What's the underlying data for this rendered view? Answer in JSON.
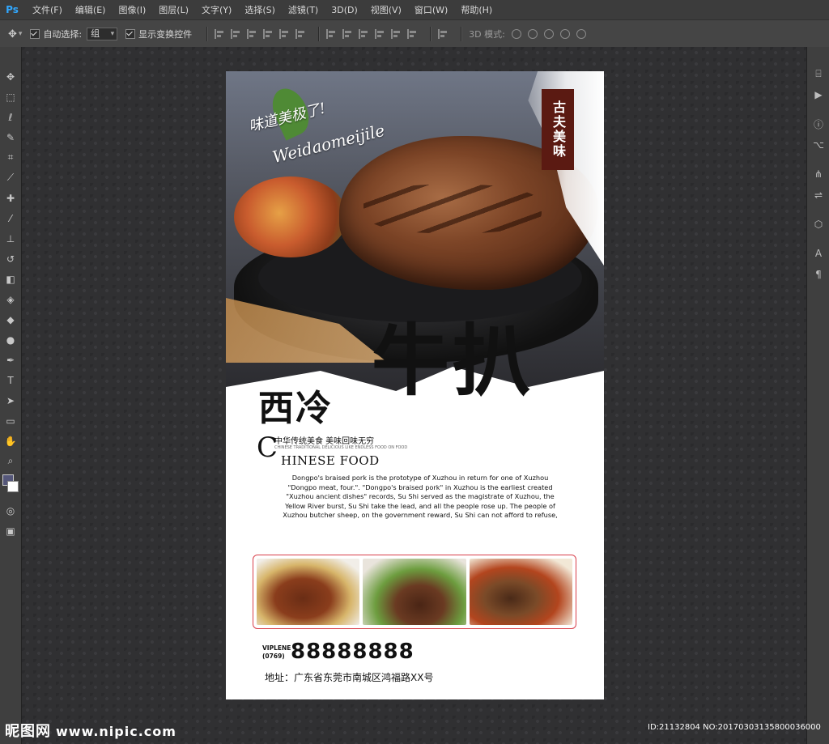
{
  "app": {
    "logo": "Ps"
  },
  "menu": [
    "文件(F)",
    "编辑(E)",
    "图像(I)",
    "图层(L)",
    "文字(Y)",
    "选择(S)",
    "滤镜(T)",
    "3D(D)",
    "视图(V)",
    "窗口(W)",
    "帮助(H)"
  ],
  "options": {
    "auto_select_label": "自动选择:",
    "auto_select_value": "组",
    "show_transform_label": "显示变换控件",
    "mode3d_label": "3D 模式:"
  },
  "poster": {
    "script_cn": "味道美极了!",
    "script_en": "Weidaomeijile",
    "seal_text": "古夫美味",
    "title_small": "西冷",
    "title_big": "牛扒",
    "tagline": "中华传统美食  美味回味无穷",
    "tiny_line": "CHINESE TRADITIONAL DELICIOUS LIKE ENDLESS FOOD ON FOOD",
    "chinese_food_c": "C",
    "chinese_food_rest": "HINESE FOOD",
    "paragraph": "Dongpo's braised pork is the prototype of Xuzhou in return for one of Xuzhou \"Dongpo meat, four.\". \"Dongpo's braised pork\" in Xuzhou is the earliest created \"Xuzhou ancient dishes\" records, Su Shi served as the magistrate of Xuzhou, the Yellow River burst, Su Shi take the lead, and all the people rose up. The people of Xuzhou butcher sheep, on the government reward, Su Shi can not afford to refuse,",
    "phone_label_1": "VIPLENE",
    "phone_label_2": "(0769)",
    "phone": "88888888",
    "address": "地址：广东省东莞市南城区鸿福路XX号"
  },
  "watermark": {
    "left_brand": "昵图网",
    "left_url": "www.nipic.com",
    "right_id": "ID:21132804 NO:20170303135800036000"
  }
}
